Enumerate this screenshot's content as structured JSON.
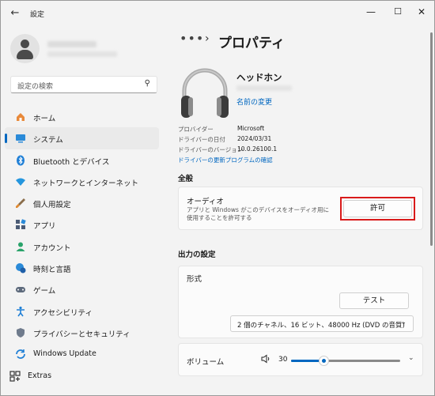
{
  "window": {
    "title": "設定",
    "back_glyph": "←",
    "min_glyph": "—",
    "max_glyph": "☐",
    "close_glyph": "✕"
  },
  "search": {
    "placeholder": "設定の検索"
  },
  "sidebar": {
    "items": [
      {
        "label": "ホーム",
        "icon": "home-icon",
        "active": false
      },
      {
        "label": "システム",
        "icon": "system-icon",
        "active": true
      },
      {
        "label": "Bluetooth とデバイス",
        "icon": "bluetooth-icon",
        "active": false
      },
      {
        "label": "ネットワークとインターネット",
        "icon": "network-icon",
        "active": false
      },
      {
        "label": "個人用設定",
        "icon": "personalization-icon",
        "active": false
      },
      {
        "label": "アプリ",
        "icon": "apps-icon",
        "active": false
      },
      {
        "label": "アカウント",
        "icon": "accounts-icon",
        "active": false
      },
      {
        "label": "時刻と言語",
        "icon": "time-language-icon",
        "active": false
      },
      {
        "label": "ゲーム",
        "icon": "gaming-icon",
        "active": false
      },
      {
        "label": "アクセシビリティ",
        "icon": "accessibility-icon",
        "active": false
      },
      {
        "label": "プライバシーとセキュリティ",
        "icon": "privacy-icon",
        "active": false
      },
      {
        "label": "Windows Update",
        "icon": "windows-update-icon",
        "active": false
      },
      {
        "label": "Extras",
        "icon": "extras-icon",
        "active": false
      }
    ]
  },
  "breadcrumb": {
    "dots": "•••",
    "sep": "›",
    "title": "プロパティ"
  },
  "device": {
    "name": "ヘッドホン",
    "rename": "名前の変更"
  },
  "properties": [
    {
      "key": "プロバイダー",
      "value": "Microsoft"
    },
    {
      "key": "ドライバーの日付",
      "value": "2024/03/31"
    },
    {
      "key": "ドライバーのバージョン",
      "value": "10.0.26100.1"
    }
  ],
  "update_link": "ドライバーの更新プログラムの確認",
  "general": {
    "heading": "全般",
    "audio_title": "オーディオ",
    "audio_desc": "アプリと Windows がこのデバイスをオーディオ用に使用することを許可する",
    "allow_label": "許可"
  },
  "output": {
    "heading": "出力の設定",
    "format_title": "形式",
    "test_label": "テスト",
    "format_value": "2 個のチャネル、16 ビット、48000 Hz (DVD の音質)",
    "volume_title": "ボリューム",
    "volume_value": "30",
    "volume_level": 0.3
  },
  "colors": {
    "accent": "#0067c0",
    "highlight": "#d91a1a"
  }
}
